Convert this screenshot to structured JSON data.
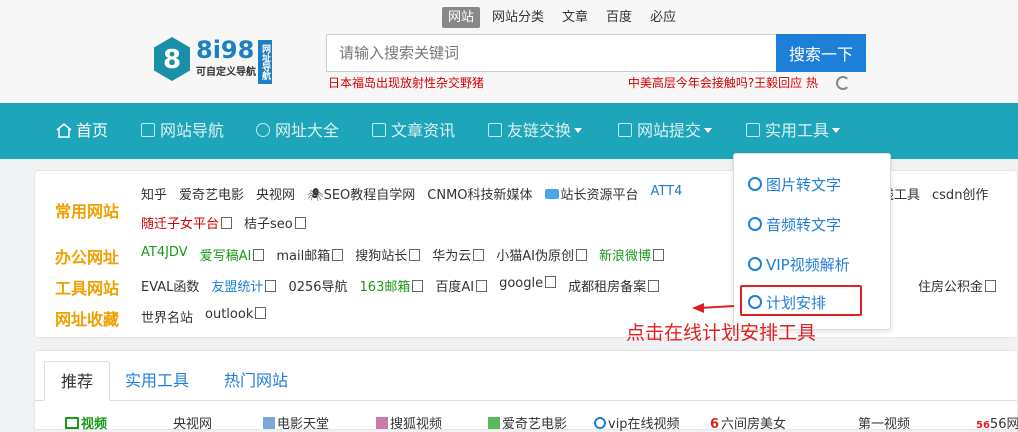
{
  "search_tabs": [
    "网站",
    "网站分类",
    "文章",
    "百度",
    "必应"
  ],
  "logo": {
    "main": "8i98",
    "sub": "可自定义导航",
    "tag": "网址导航"
  },
  "search": {
    "placeholder": "请输入搜索关键词",
    "button": "搜索一下"
  },
  "hot_links": [
    "日本福岛出现放射性杂交野猪",
    "中美高层今年会接触吗?王毅回应 热"
  ],
  "nav": [
    {
      "label": "首页",
      "icon": "home-icon"
    },
    {
      "label": "网站导航",
      "icon": "grid-icon"
    },
    {
      "label": "网址大全",
      "icon": "ie-icon"
    },
    {
      "label": "文章资讯",
      "icon": "bars-icon"
    },
    {
      "label": "友链交换",
      "icon": "image-icon",
      "caret": true
    },
    {
      "label": "网站提交",
      "icon": "monitor-icon",
      "caret": true
    },
    {
      "label": "实用工具",
      "icon": "window-icon",
      "caret": true
    }
  ],
  "categories": [
    {
      "label": "常用网站"
    },
    {
      "label": "办公网址"
    },
    {
      "label": "工具网站"
    },
    {
      "label": "网址收藏"
    }
  ],
  "rows": {
    "common_1": [
      "知乎",
      "爱奇艺电影",
      "央视网",
      "SEO教程自学网",
      "CNMO科技新媒体",
      "站长资源平台",
      "ATT4",
      "线工具",
      "csdn创作"
    ],
    "common_2": [
      "随迁子女平台",
      "桔子seo"
    ],
    "office": [
      "AT4JDV",
      "爱写稿AI",
      "mail邮箱",
      "搜狗站长",
      "华为云",
      "小猫AI伪原创",
      "新浪微博"
    ],
    "tools": [
      "EVAL函数",
      "友盟统计",
      "0256导航",
      "163邮箱",
      "百度AI",
      "google",
      "成都租房备案",
      "住房公积金"
    ],
    "favorites": [
      "世界名站",
      "outlook"
    ]
  },
  "dropdown": [
    "图片转文字",
    "音频转文字",
    "VIP视频解析",
    "计划安排"
  ],
  "annotation": "点击在线计划安排工具",
  "tabs": [
    "推荐",
    "实用工具",
    "热门网站"
  ],
  "bottom_links": [
    "视频",
    "央视网",
    "电影天堂",
    "搜狐视频",
    "爱奇艺电影",
    "vip在线视频",
    "六间房美女",
    "第一视频",
    "56网"
  ],
  "colors": {
    "nav_bg": "#1da5b9",
    "accent_blue": "#1e7fd9",
    "label_orange": "#f0a000",
    "annotation_red": "#e02020"
  }
}
